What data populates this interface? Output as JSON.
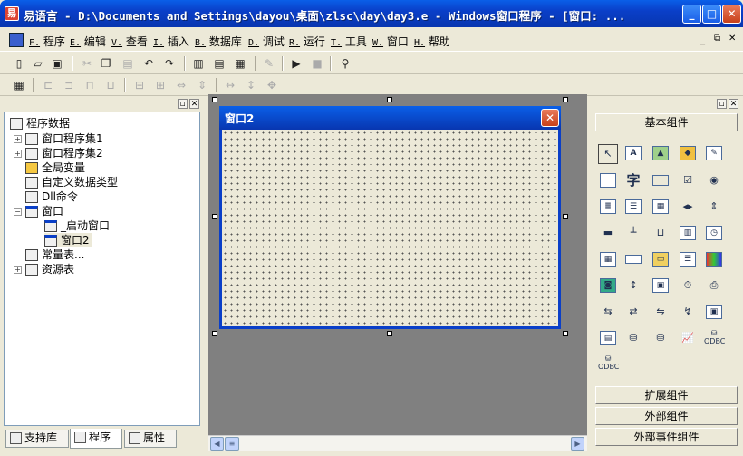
{
  "window": {
    "title": "易语言 - D:\\Documents and Settings\\dayou\\桌面\\zlsc\\day\\day3.e - Windows窗口程序 - [窗口: ..."
  },
  "menu": [
    {
      "key": "F.",
      "label": "程序"
    },
    {
      "key": "E.",
      "label": "编辑"
    },
    {
      "key": "V.",
      "label": "查看"
    },
    {
      "key": "I.",
      "label": "插入"
    },
    {
      "key": "B.",
      "label": "数据库"
    },
    {
      "key": "D.",
      "label": "调试"
    },
    {
      "key": "R.",
      "label": "运行"
    },
    {
      "key": "T.",
      "label": "工具"
    },
    {
      "key": "W.",
      "label": "窗口"
    },
    {
      "key": "H.",
      "label": "帮助"
    }
  ],
  "tree": {
    "root": "程序数据",
    "items": [
      "窗口程序集1",
      "窗口程序集2",
      "全局变量",
      "自定义数据类型",
      "Dll命令",
      "窗口",
      "_启动窗口",
      "窗口2",
      "常量表...",
      "资源表"
    ]
  },
  "tabs": [
    "支持库",
    "程序",
    "属性"
  ],
  "form": {
    "title": "窗口2",
    "close_glyph": "✕"
  },
  "palette": {
    "groups": {
      "basic": "基本组件",
      "extended": "扩展组件",
      "external": "外部组件",
      "external_event": "外部事件组件"
    },
    "label_tool_text": "字",
    "odbc_label": "ODBC"
  },
  "colors": {
    "titlebar": "#0a3fc8",
    "workspace": "#808080",
    "chrome": "#ece9d8"
  }
}
